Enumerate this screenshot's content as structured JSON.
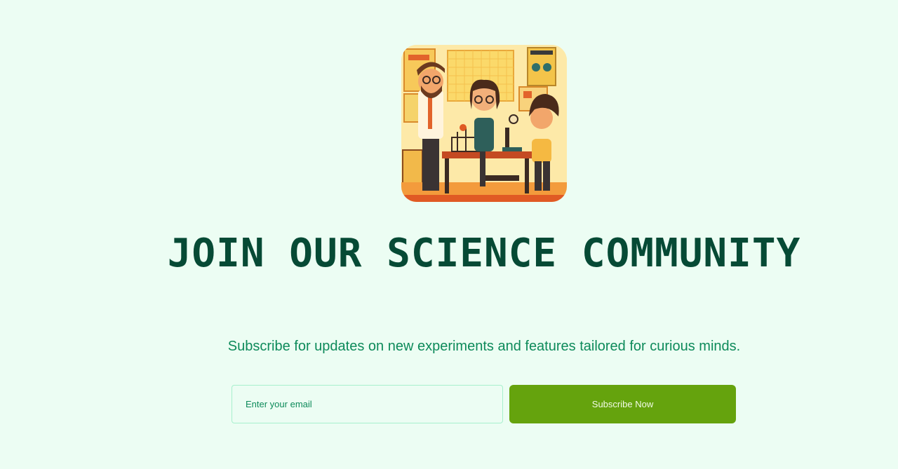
{
  "hero": {
    "image_icon": "science-classroom-illustration",
    "title": "Join Our Science Community",
    "subtitle": "Subscribe for updates on new experiments and features tailored for curious minds."
  },
  "subscribe_form": {
    "email_placeholder": "Enter your email",
    "email_value": "",
    "button_label": "Subscribe Now"
  },
  "colors": {
    "background": "#ecfdf3",
    "title": "#064a35",
    "subtitle": "#0d8a5a",
    "button": "#65a30d",
    "input_border": "#a7f0cd"
  }
}
